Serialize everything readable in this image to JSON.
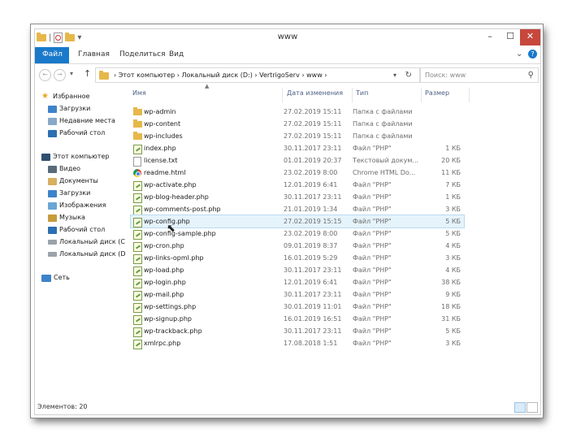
{
  "window": {
    "title": "www",
    "controls": {
      "minimize": "–",
      "maximize": "☐",
      "close": "✕"
    }
  },
  "ribbon": {
    "tabs": [
      "Файл",
      "Главная",
      "Поделиться",
      "Вид"
    ]
  },
  "nav": {
    "breadcrumb": [
      "Этот компьютер",
      "Локальный диск (D:)",
      "VertrigoServ",
      "www"
    ],
    "breadcrumb_text": "›  Этот компьютер  ›  Локальный диск (D:)  ›  VertrigoServ  ›  www  ›",
    "search_placeholder": "Поиск: www"
  },
  "sidebar": {
    "favorites_label": "Избранное",
    "favorites": [
      "Загрузки",
      "Недавние места",
      "Рабочий стол"
    ],
    "computer_label": "Этот компьютер",
    "computer": [
      "Видео",
      "Документы",
      "Загрузки",
      "Изображения",
      "Музыка",
      "Рабочий стол",
      "Локальный диск (C",
      "Локальный диск (D"
    ],
    "network_label": "Сеть"
  },
  "columns": {
    "name": "Имя",
    "date": "Дата изменения",
    "type": "Тип",
    "size": "Размер"
  },
  "files": [
    {
      "name": "wp-admin",
      "date": "27.02.2019 15:11",
      "type": "Папка с файлами",
      "size": "",
      "icon": "folder-icon"
    },
    {
      "name": "wp-content",
      "date": "27.02.2019 15:11",
      "type": "Папка с файлами",
      "size": "",
      "icon": "folder-icon"
    },
    {
      "name": "wp-includes",
      "date": "27.02.2019 15:11",
      "type": "Папка с файлами",
      "size": "",
      "icon": "folder-icon"
    },
    {
      "name": "index.php",
      "date": "30.11.2017 23:11",
      "type": "Файл \"PHP\"",
      "size": "1 КБ",
      "icon": "php-file-icon"
    },
    {
      "name": "license.txt",
      "date": "01.01.2019 20:37",
      "type": "Текстовый докум...",
      "size": "20 КБ",
      "icon": "text-file-icon"
    },
    {
      "name": "readme.html",
      "date": "23.02.2019 8:00",
      "type": "Chrome HTML Do...",
      "size": "11 КБ",
      "icon": "chrome-icon"
    },
    {
      "name": "wp-activate.php",
      "date": "12.01.2019 6:41",
      "type": "Файл \"PHP\"",
      "size": "7 КБ",
      "icon": "php-file-icon"
    },
    {
      "name": "wp-blog-header.php",
      "date": "30.11.2017 23:11",
      "type": "Файл \"PHP\"",
      "size": "1 КБ",
      "icon": "php-file-icon"
    },
    {
      "name": "wp-comments-post.php",
      "date": "21.01.2019 1:34",
      "type": "Файл \"PHP\"",
      "size": "3 КБ",
      "icon": "php-file-icon"
    },
    {
      "name": "wp-config.php",
      "date": "27.02.2019 15:15",
      "type": "Файл \"PHP\"",
      "size": "5 КБ",
      "icon": "php-file-icon",
      "selected": true
    },
    {
      "name": "wp-config-sample.php",
      "date": "23.02.2019 8:00",
      "type": "Файл \"PHP\"",
      "size": "5 КБ",
      "icon": "php-file-icon"
    },
    {
      "name": "wp-cron.php",
      "date": "09.01.2019 8:37",
      "type": "Файл \"PHP\"",
      "size": "4 КБ",
      "icon": "php-file-icon"
    },
    {
      "name": "wp-links-opml.php",
      "date": "16.01.2019 5:29",
      "type": "Файл \"PHP\"",
      "size": "3 КБ",
      "icon": "php-file-icon"
    },
    {
      "name": "wp-load.php",
      "date": "30.11.2017 23:11",
      "type": "Файл \"PHP\"",
      "size": "4 КБ",
      "icon": "php-file-icon"
    },
    {
      "name": "wp-login.php",
      "date": "12.01.2019 6:41",
      "type": "Файл \"PHP\"",
      "size": "38 КБ",
      "icon": "php-file-icon"
    },
    {
      "name": "wp-mail.php",
      "date": "30.11.2017 23:11",
      "type": "Файл \"PHP\"",
      "size": "9 КБ",
      "icon": "php-file-icon"
    },
    {
      "name": "wp-settings.php",
      "date": "30.01.2019 11:01",
      "type": "Файл \"PHP\"",
      "size": "18 КБ",
      "icon": "php-file-icon"
    },
    {
      "name": "wp-signup.php",
      "date": "16.01.2019 16:51",
      "type": "Файл \"PHP\"",
      "size": "31 КБ",
      "icon": "php-file-icon"
    },
    {
      "name": "wp-trackback.php",
      "date": "30.11.2017 23:11",
      "type": "Файл \"PHP\"",
      "size": "5 КБ",
      "icon": "php-file-icon"
    },
    {
      "name": "xmlrpc.php",
      "date": "17.08.2018 1:51",
      "type": "Файл \"PHP\"",
      "size": "3 КБ",
      "icon": "php-file-icon"
    }
  ],
  "status": {
    "items_text": "Элементов: 20"
  },
  "colors": {
    "accent": "#1979ca",
    "selection": "#e5f3fb",
    "close_button": "#c7473c"
  }
}
